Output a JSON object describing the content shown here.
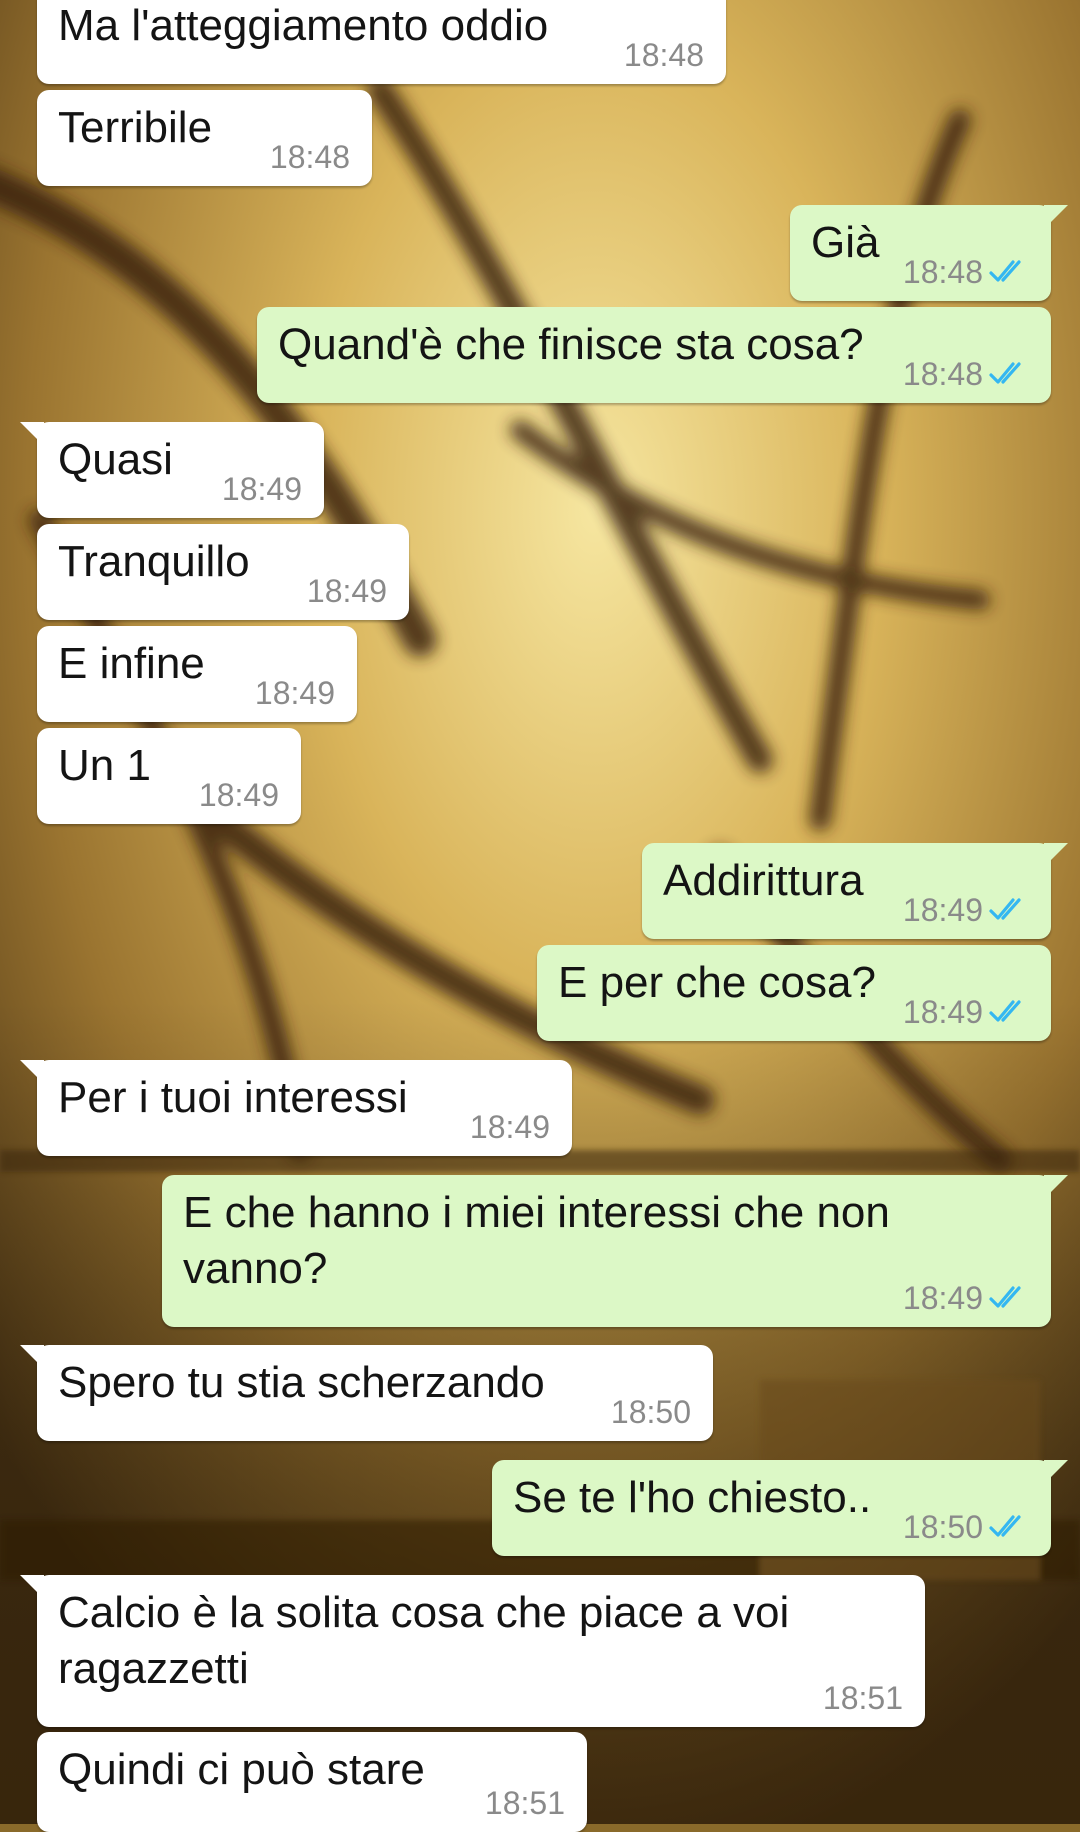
{
  "colors": {
    "incoming_bubble": "#ffffff",
    "outgoing_bubble": "#dcf8c6",
    "read_ticks": "#34b7f1",
    "timestamp": "#8a8a8a"
  },
  "messages": [
    {
      "dir": "in",
      "text": "Ma l'atteggiamento oddio",
      "time": "18:48"
    },
    {
      "dir": "in",
      "text": "Terribile",
      "time": "18:48"
    },
    {
      "dir": "out",
      "text": "Già",
      "time": "18:48",
      "status_icon": "double-check-read-icon"
    },
    {
      "dir": "out",
      "text": "Quand'è che finisce sta cosa?",
      "time": "18:48",
      "status_icon": "double-check-read-icon"
    },
    {
      "dir": "in",
      "text": "Quasi",
      "time": "18:49"
    },
    {
      "dir": "in",
      "text": "Tranquillo",
      "time": "18:49"
    },
    {
      "dir": "in",
      "text": "E infine",
      "time": "18:49"
    },
    {
      "dir": "in",
      "text": "Un 1",
      "time": "18:49"
    },
    {
      "dir": "out",
      "text": "Addirittura",
      "time": "18:49",
      "status_icon": "double-check-read-icon"
    },
    {
      "dir": "out",
      "text": "E per che cosa?",
      "time": "18:49",
      "status_icon": "double-check-read-icon"
    },
    {
      "dir": "in",
      "text": "Per i tuoi interessi",
      "time": "18:49"
    },
    {
      "dir": "out",
      "text": "E che hanno i miei interessi che non\nvanno?",
      "time": "18:49",
      "status_icon": "double-check-read-icon"
    },
    {
      "dir": "in",
      "text": "Spero tu stia scherzando",
      "time": "18:50"
    },
    {
      "dir": "out",
      "text": "Se te l'ho chiesto..",
      "time": "18:50",
      "status_icon": "double-check-read-icon"
    },
    {
      "dir": "in",
      "text": "Calcio è la solita cosa che piace a voi\nragazzetti",
      "time": "18:51"
    },
    {
      "dir": "in",
      "text": "Quindi ci può stare",
      "time": "18:51"
    }
  ]
}
